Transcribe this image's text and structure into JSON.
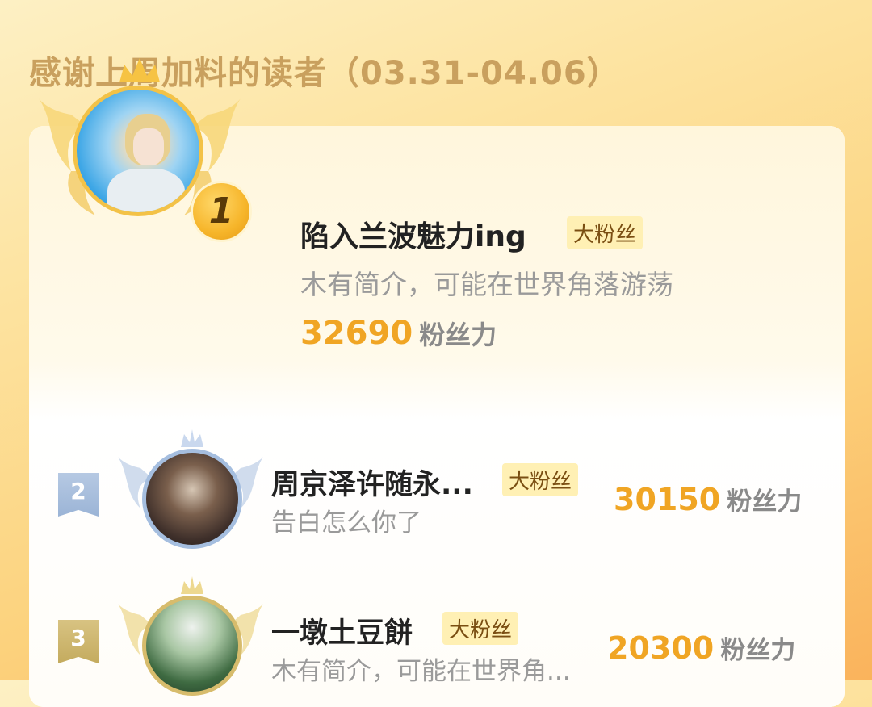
{
  "header": {
    "title": "感谢上周加料的读者（03.31-04.06）"
  },
  "ranking": [
    {
      "rank": "1",
      "name": "陷入兰波魅力ing",
      "tag": "大粉丝",
      "desc": "木有简介，可能在世界角落游荡",
      "score": "32690",
      "unit": "粉丝力"
    },
    {
      "rank": "2",
      "name": "周京泽许随永...",
      "tag": "大粉丝",
      "desc": "告白怎么你了",
      "score": "30150",
      "unit": "粉丝力"
    },
    {
      "rank": "3",
      "name": "一墩土豆餅",
      "tag": "大粉丝",
      "desc": "木有简介，可能在世界角...",
      "score": "20300",
      "unit": "粉丝力"
    }
  ],
  "colors": {
    "gold": "#f0a524",
    "silver": "#a5bedf",
    "bronze": "#d7bc6c",
    "tag_bg": "#fff0b4"
  },
  "icons": [
    "crown-icon",
    "wings-icon",
    "rank-badge-icon"
  ]
}
